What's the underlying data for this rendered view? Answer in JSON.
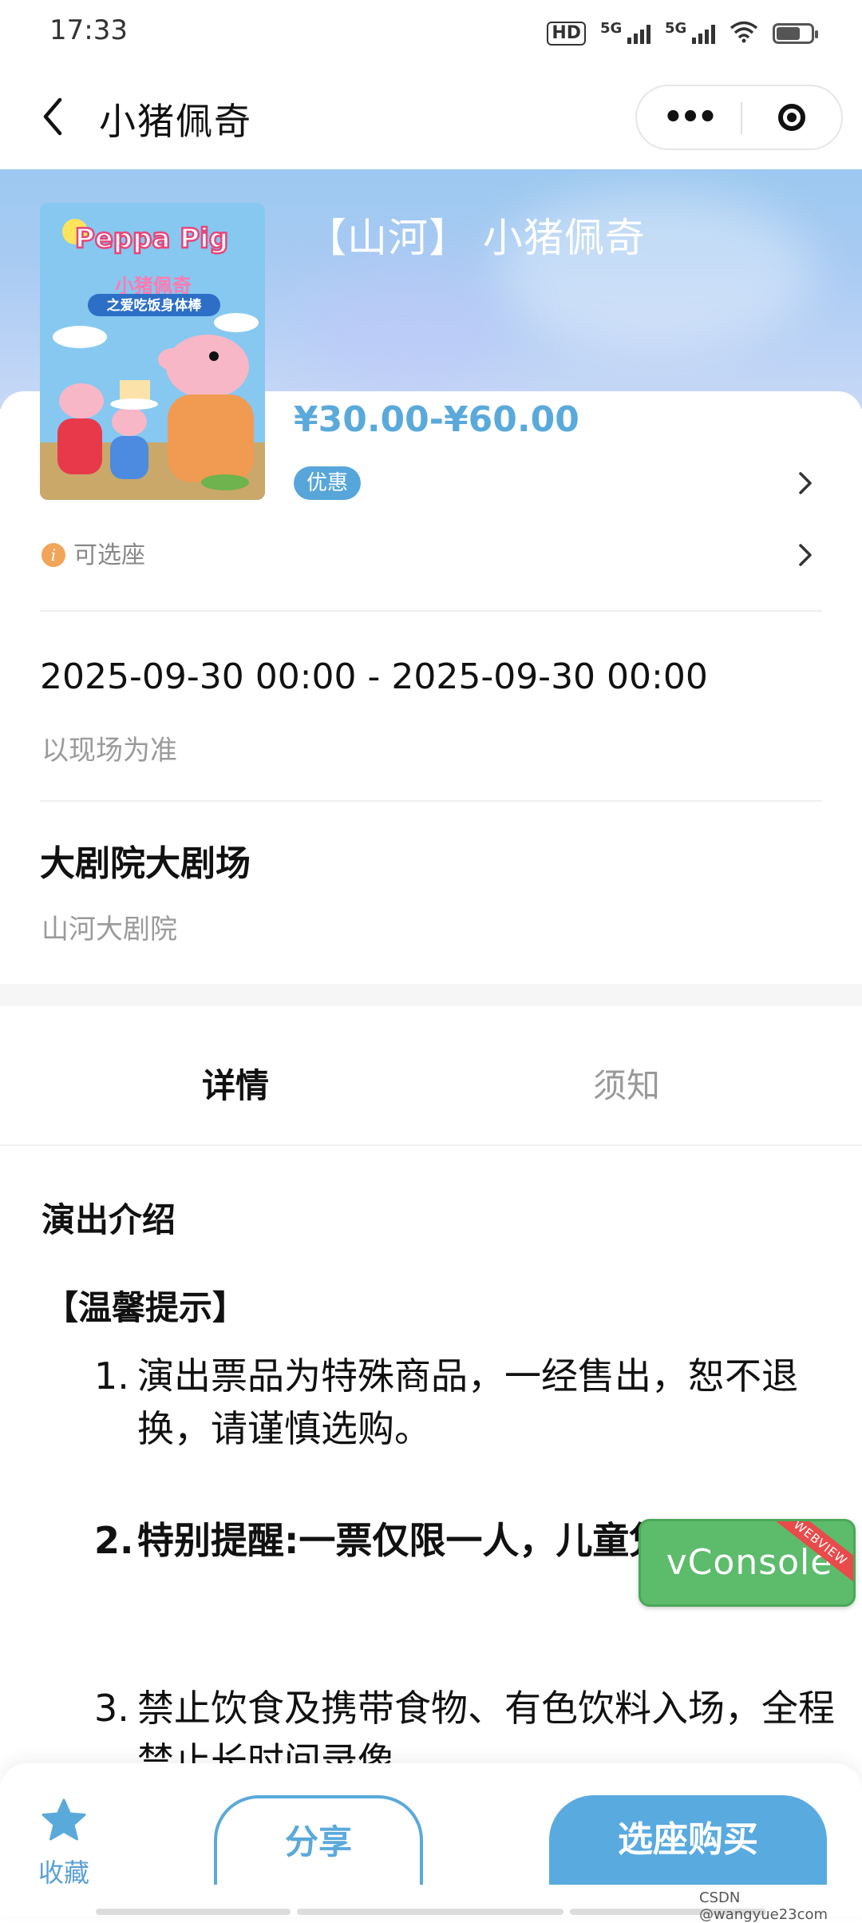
{
  "status_bar": {
    "time": "17:33",
    "icons": [
      "hd-icon",
      "signal-5g-icon",
      "signal-5g-icon",
      "wifi-icon",
      "battery-icon"
    ],
    "hd_label": "HD",
    "sig1_label": "5G",
    "sig2_label": "5G"
  },
  "nav": {
    "title": "小猪佩奇",
    "more_label": "•••"
  },
  "event": {
    "title": "【山河】 小猪佩奇",
    "poster_brand": "Peppa Pig",
    "poster_cn_title": "小猪佩奇",
    "poster_subtitle": "之爱吃饭身体棒",
    "price_range": "¥30.00-¥60.00",
    "promo_badge": "优惠",
    "seat_selectable": "可选座",
    "date_range": "2025-09-30 00:00 - 2025-09-30 00:00",
    "date_note": "以现场为准",
    "venue_name": "大剧院大剧场",
    "venue_address": "山河大剧院"
  },
  "tabs": [
    {
      "label": "详情",
      "active": true
    },
    {
      "label": "须知",
      "active": false
    }
  ],
  "details": {
    "heading": "演出介绍",
    "tip_heading": "【温馨提示】",
    "items": [
      {
        "num": "1.",
        "text": "演出票品为特殊商品，一经售出，恕不退换，请谨慎选购。"
      },
      {
        "num": "2.",
        "text": "特别提醒:一票仅限一人，儿童凭票入场。"
      },
      {
        "num": "3.",
        "text": "禁止饮食及携带食物、有色饮料入场，全程禁止长时间录像"
      }
    ]
  },
  "vconsole": {
    "label": "vConsole",
    "ribbon": "WEBVIEW"
  },
  "bottom_bar": {
    "favorite_label": "收藏",
    "share_label": "分享",
    "buy_label": "选座购买"
  },
  "watermark": "CSDN @wangyue23com",
  "colors": {
    "accent": "#59aadf",
    "price": "#5aa9db",
    "info_dot": "#f0a55a",
    "vconsole": "#5dbb6c",
    "ribbon": "#e94a4a"
  }
}
